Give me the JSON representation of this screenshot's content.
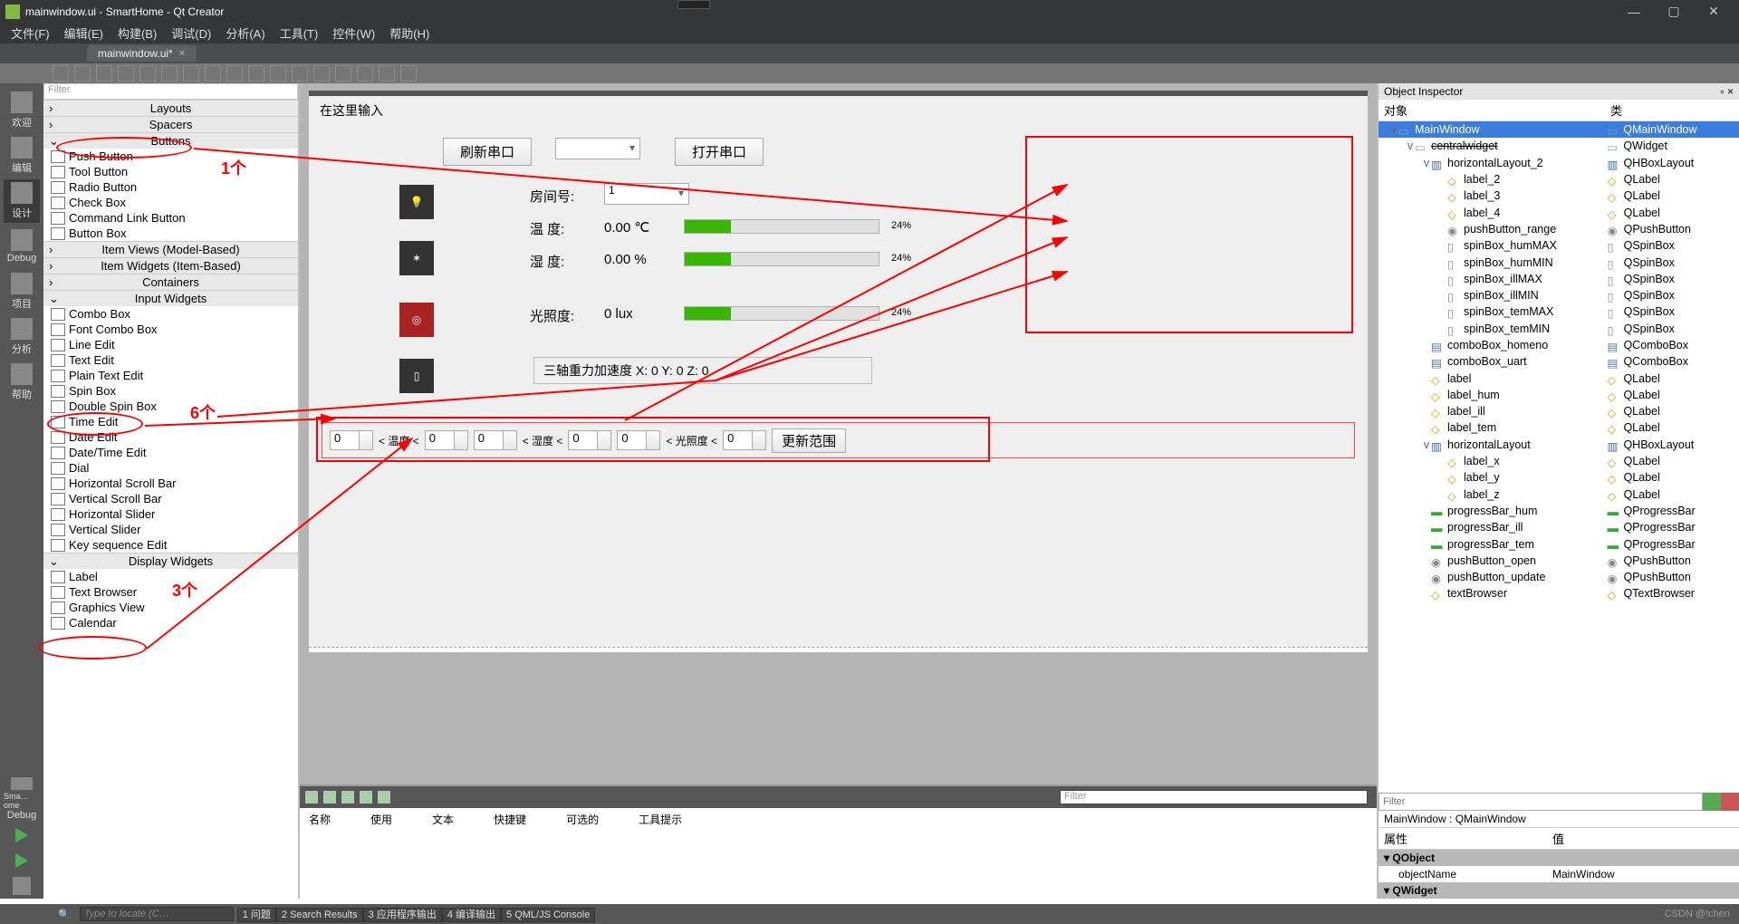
{
  "window": {
    "title": "mainwindow.ui - SmartHome - Qt Creator"
  },
  "menu": {
    "file": "文件(F)",
    "edit": "编辑(E)",
    "build": "构建(B)",
    "debug": "调试(D)",
    "analyze": "分析(A)",
    "tools": "工具(T)",
    "widgets": "控件(W)",
    "help": "帮助(H)"
  },
  "tab": {
    "name": "mainwindow.ui*"
  },
  "modes": {
    "welcome": "欢迎",
    "edit": "编辑",
    "design": "设计",
    "debug": "Debug",
    "project": "项目",
    "analyze": "分析",
    "help": "帮助",
    "small": "Sma…ome",
    "debug2": "Debug"
  },
  "widgetbox": {
    "filter": "Filter",
    "cats": {
      "layouts": "Layouts",
      "spacers": "Spacers",
      "buttons": "Buttons",
      "itemviews": "Item Views (Model-Based)",
      "itemwidgets": "Item Widgets (Item-Based)",
      "containers": "Containers",
      "input": "Input Widgets",
      "display": "Display Widgets"
    },
    "buttons": [
      "Push Button",
      "Tool Button",
      "Radio Button",
      "Check Box",
      "Command Link Button",
      "Button Box"
    ],
    "input": [
      "Combo Box",
      "Font Combo Box",
      "Line Edit",
      "Text Edit",
      "Plain Text Edit",
      "Spin Box",
      "Double Spin Box",
      "Time Edit",
      "Date Edit",
      "Date/Time Edit",
      "Dial",
      "Horizontal Scroll Bar",
      "Vertical Scroll Bar",
      "Horizontal Slider",
      "Vertical Slider",
      "Key sequence Edit"
    ],
    "display": [
      "Label",
      "Text Browser",
      "Graphics View",
      "Calendar"
    ]
  },
  "anno": {
    "a1": "1个",
    "a6": "6个",
    "a3": "3个"
  },
  "form": {
    "placeholder": "在这里输入",
    "refresh": "刷新串口",
    "open": "打开串口",
    "room": "房间号:",
    "room_val": "1",
    "temp": "温    度:",
    "temp_val": "0.00 ℃",
    "hum": "湿    度:",
    "hum_val": "0.00 %",
    "ill": "光照度:",
    "ill_val": "0 lux",
    "pct": "24%",
    "accel": "三轴重力加速度 X: 0     Y: 0         Z: 0",
    "lt": "< 温度 <",
    "lh": "< 湿度 <",
    "li": "< 光照度 <",
    "sp": "0",
    "update": "更新范围"
  },
  "actcols": [
    "名称",
    "使用",
    "文本",
    "快捷键",
    "可选的",
    "工具提示"
  ],
  "actfilter": "Filter",
  "inspector": {
    "title": "Object Inspector",
    "cols": {
      "obj": "对象",
      "cls": "类"
    },
    "rows": [
      {
        "pad": 0,
        "chev": "v",
        "n": "MainWindow",
        "c": "QMainWindow",
        "sel": true,
        "ni": "i-qw",
        "ci": "i-qw"
      },
      {
        "pad": 1,
        "chev": "v",
        "n": "centralwidget",
        "c": "QWidget",
        "ni": "i-qw",
        "ci": "i-qw",
        "strike": true
      },
      {
        "pad": 2,
        "chev": "v",
        "n": "horizontalLayout_2",
        "c": "QHBoxLayout",
        "ni": "i-lay",
        "ci": "i-lay"
      },
      {
        "pad": 3,
        "n": "label_2",
        "c": "QLabel",
        "ni": "i-la",
        "ci": "i-la"
      },
      {
        "pad": 3,
        "n": "label_3",
        "c": "QLabel",
        "ni": "i-la",
        "ci": "i-la"
      },
      {
        "pad": 3,
        "n": "label_4",
        "c": "QLabel",
        "ni": "i-la",
        "ci": "i-la"
      },
      {
        "pad": 3,
        "n": "pushButton_range",
        "c": "QPushButton",
        "ni": "i-pb",
        "ci": "i-pb"
      },
      {
        "pad": 3,
        "n": "spinBox_humMAX",
        "c": "QSpinBox",
        "ni": "i-sp",
        "ci": "i-sp"
      },
      {
        "pad": 3,
        "n": "spinBox_humMIN",
        "c": "QSpinBox",
        "ni": "i-sp",
        "ci": "i-sp"
      },
      {
        "pad": 3,
        "n": "spinBox_illMAX",
        "c": "QSpinBox",
        "ni": "i-sp",
        "ci": "i-sp"
      },
      {
        "pad": 3,
        "n": "spinBox_illMIN",
        "c": "QSpinBox",
        "ni": "i-sp",
        "ci": "i-sp"
      },
      {
        "pad": 3,
        "n": "spinBox_temMAX",
        "c": "QSpinBox",
        "ni": "i-sp",
        "ci": "i-sp"
      },
      {
        "pad": 3,
        "n": "spinBox_temMIN",
        "c": "QSpinBox",
        "ni": "i-sp",
        "ci": "i-sp"
      },
      {
        "pad": 2,
        "n": "comboBox_homeno",
        "c": "QComboBox",
        "ni": "i-cb",
        "ci": "i-cb"
      },
      {
        "pad": 2,
        "n": "comboBox_uart",
        "c": "QComboBox",
        "ni": "i-cb",
        "ci": "i-cb"
      },
      {
        "pad": 2,
        "n": "label",
        "c": "QLabel",
        "ni": "i-la",
        "ci": "i-la"
      },
      {
        "pad": 2,
        "n": "label_hum",
        "c": "QLabel",
        "ni": "i-la",
        "ci": "i-la"
      },
      {
        "pad": 2,
        "n": "label_ill",
        "c": "QLabel",
        "ni": "i-la",
        "ci": "i-la"
      },
      {
        "pad": 2,
        "n": "label_tem",
        "c": "QLabel",
        "ni": "i-la",
        "ci": "i-la"
      },
      {
        "pad": 2,
        "chev": "v",
        "n": "horizontalLayout",
        "c": "QHBoxLayout",
        "ni": "i-lay",
        "ci": "i-lay"
      },
      {
        "pad": 3,
        "n": "label_x",
        "c": "QLabel",
        "ni": "i-la",
        "ci": "i-la"
      },
      {
        "pad": 3,
        "n": "label_y",
        "c": "QLabel",
        "ni": "i-la",
        "ci": "i-la"
      },
      {
        "pad": 3,
        "n": "label_z",
        "c": "QLabel",
        "ni": "i-la",
        "ci": "i-la"
      },
      {
        "pad": 2,
        "n": "progressBar_hum",
        "c": "QProgressBar",
        "ni": "i-prog",
        "ci": "i-prog"
      },
      {
        "pad": 2,
        "n": "progressBar_ill",
        "c": "QProgressBar",
        "ni": "i-prog",
        "ci": "i-prog"
      },
      {
        "pad": 2,
        "n": "progressBar_tem",
        "c": "QProgressBar",
        "ni": "i-prog",
        "ci": "i-prog"
      },
      {
        "pad": 2,
        "n": "pushButton_open",
        "c": "QPushButton",
        "ni": "i-pb",
        "ci": "i-pb"
      },
      {
        "pad": 2,
        "n": "pushButton_update",
        "c": "QPushButton",
        "ni": "i-pb",
        "ci": "i-pb"
      },
      {
        "pad": 2,
        "n": "textBrowser",
        "c": "QTextBrowser",
        "ni": "i-la",
        "ci": "i-la"
      }
    ],
    "filter": "Filter",
    "pathinfo": "MainWindow : QMainWindow",
    "propcols": {
      "prop": "属性",
      "val": "值"
    },
    "cat1": "QObject",
    "pn": "objectName",
    "pv": "MainWindow",
    "cat2": "QWidget"
  },
  "status": {
    "locate": "Type to locate (C…",
    "items": [
      "1 问题",
      "2 Search Results",
      "3 应用程序输出",
      "4 编译输出",
      "5 QML/JS Console"
    ],
    "csdn": "CSDN @!chen"
  }
}
